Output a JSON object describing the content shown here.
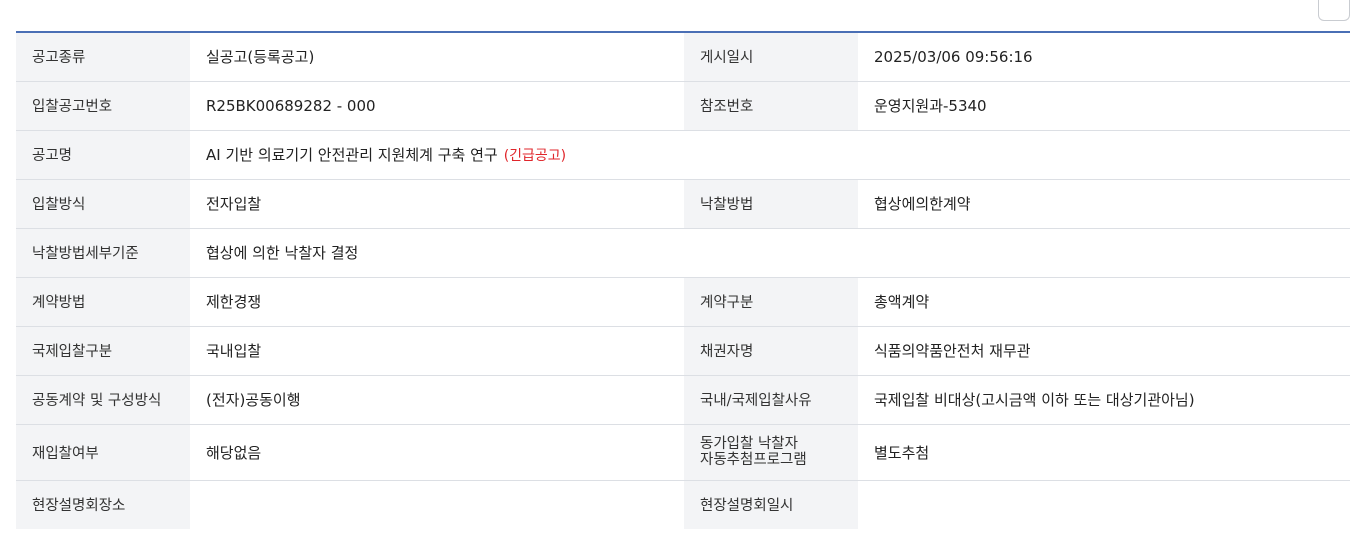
{
  "rows": [
    {
      "label1": "공고종류",
      "value1": "실공고(등록공고)",
      "label2": "게시일시",
      "value2": "2025/03/06 09:56:16"
    },
    {
      "label1": "입찰공고번호",
      "value1": "R25BK00689282 - 000",
      "label2": "참조번호",
      "value2": "운영지원과-5340"
    },
    {
      "label1": "공고명",
      "value1": "AI 기반 의료기기 안전관리 지원체계 구축 연구",
      "badge": "(긴급공고)"
    },
    {
      "label1": "입찰방식",
      "value1": "전자입찰",
      "label2": "낙찰방법",
      "value2": "협상에의한계약"
    },
    {
      "label1": "낙찰방법세부기준",
      "value1": "협상에 의한 낙찰자 결정"
    },
    {
      "label1": "계약방법",
      "value1": "제한경쟁",
      "label2": "계약구분",
      "value2": "총액계약"
    },
    {
      "label1": "국제입찰구분",
      "value1": "국내입찰",
      "label2": "채권자명",
      "value2": "식품의약품안전처 재무관"
    },
    {
      "label1": "공동계약 및 구성방식",
      "value1": "(전자)공동이행",
      "label2": "국내/국제입찰사유",
      "value2": "국제입찰 비대상(고시금액 이하 또는 대상기관아님)"
    },
    {
      "label1": "재입찰여부",
      "value1": "해당없음",
      "label2_line1": "동가입찰 낙찰자",
      "label2_line2": "자동추첨프로그램",
      "value2": "별도추첨"
    },
    {
      "label1": "현장설명회장소",
      "value1": "",
      "label2": "현장설명회일시",
      "value2": ""
    }
  ],
  "colors": {
    "header_border": "#4a6fb5",
    "label_bg": "#f3f4f6",
    "urgent": "#e0262b"
  }
}
